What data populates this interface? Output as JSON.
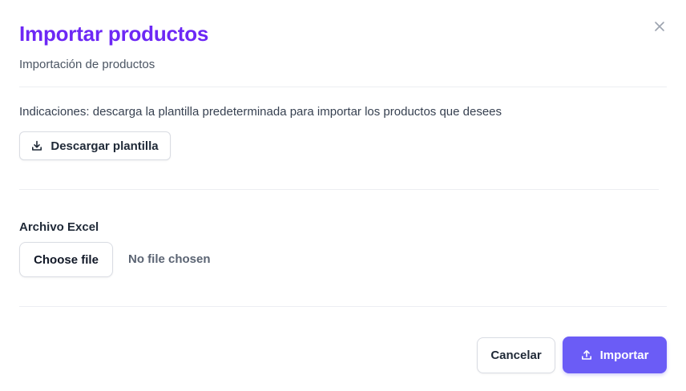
{
  "modal": {
    "title": "Importar productos",
    "subtitle": "Importación de productos",
    "close_icon": "close-icon"
  },
  "instructions": {
    "text": "Indicaciones: descarga la plantilla predeterminada para importar los productos que desees",
    "download_button": {
      "label": "Descargar plantilla",
      "icon": "download-icon"
    }
  },
  "file_field": {
    "label": "Archivo Excel",
    "choose_button": "Choose file",
    "status": "No file chosen"
  },
  "footer": {
    "cancel_label": "Cancelar",
    "import_label": "Importar",
    "import_icon": "upload-icon"
  },
  "colors": {
    "title": "#6d28f5",
    "primary_button": "#6b5cf6",
    "divider": "#eceef2"
  }
}
